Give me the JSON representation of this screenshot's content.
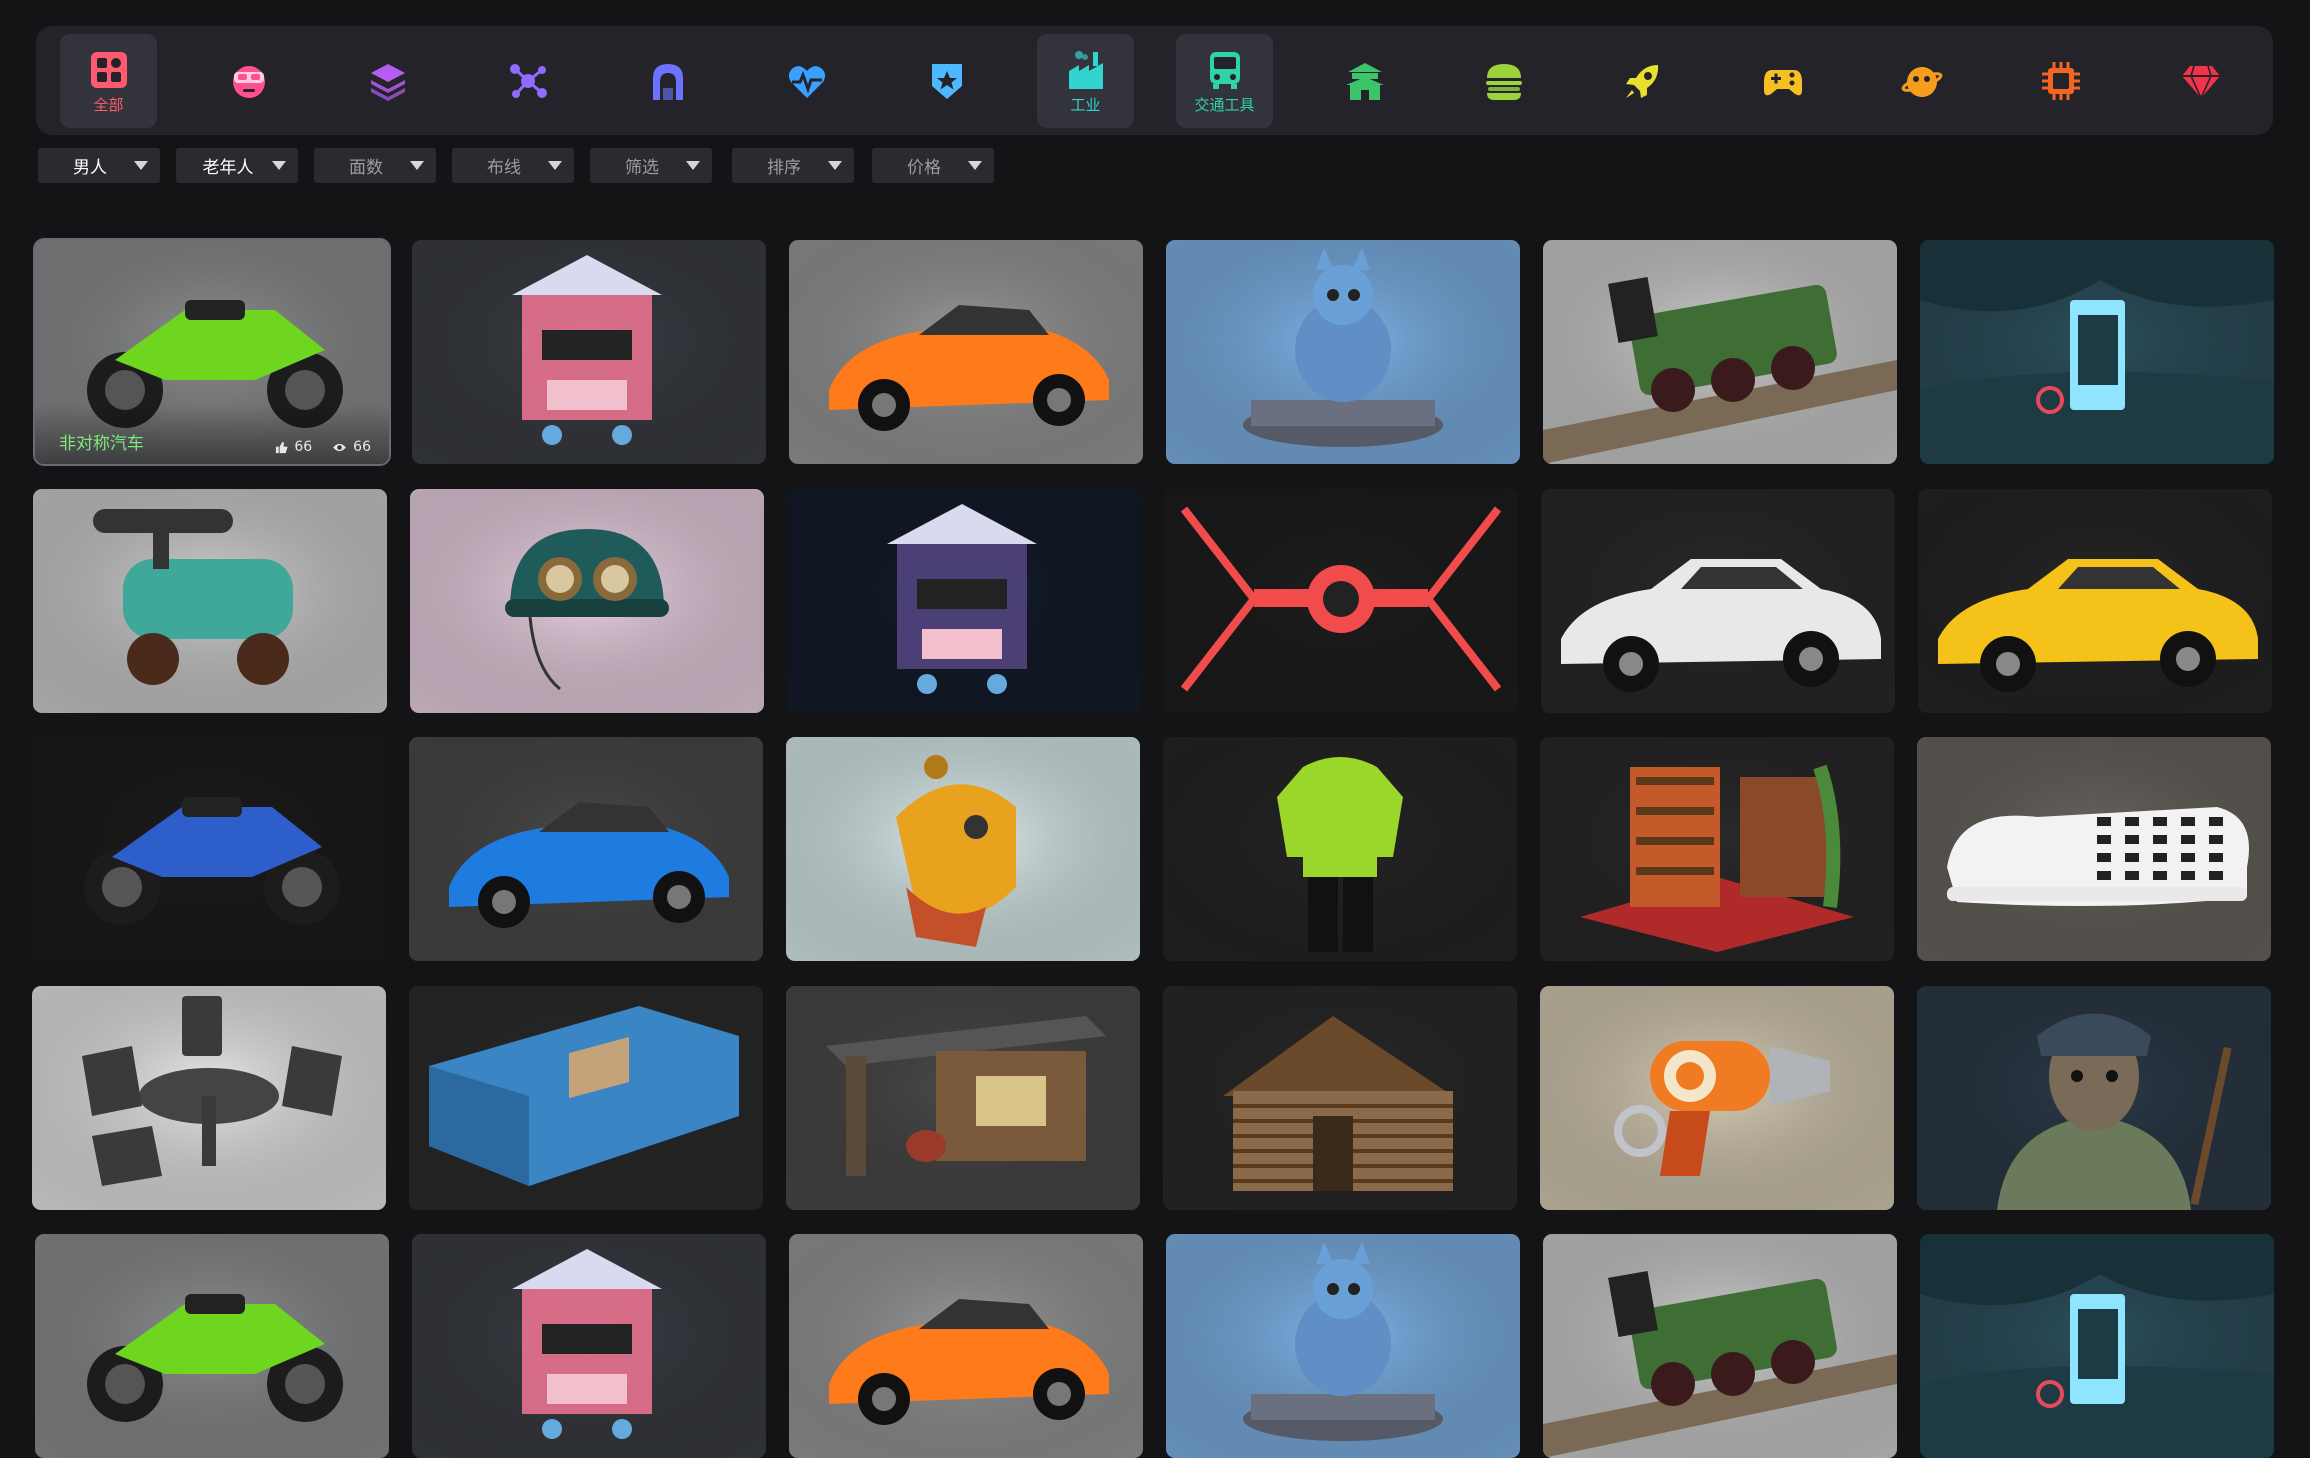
{
  "categories": [
    {
      "key": "all",
      "label": "全部",
      "icon": "all-grid-icon",
      "color": "#ff5a6e",
      "active": true
    },
    {
      "key": "character",
      "label": "",
      "icon": "vr-character-icon",
      "color": "#ff4f8e",
      "active": false
    },
    {
      "key": "layers",
      "label": "",
      "icon": "layers-icon",
      "color": "#b65cf2",
      "active": false
    },
    {
      "key": "molecule",
      "label": "",
      "icon": "molecule-icon",
      "color": "#8f6cff",
      "active": false
    },
    {
      "key": "arch",
      "label": "",
      "icon": "arch-tunnel-icon",
      "color": "#6a72ff",
      "active": false
    },
    {
      "key": "medical",
      "label": "",
      "icon": "heartbeat-icon",
      "color": "#3aa0ff",
      "active": false
    },
    {
      "key": "military",
      "label": "",
      "icon": "badge-star-icon",
      "color": "#4db8ff",
      "active": false
    },
    {
      "key": "industry",
      "label": "工业",
      "icon": "factory-icon",
      "color": "#33d3d0",
      "active": true
    },
    {
      "key": "transport",
      "label": "交通工具",
      "icon": "bus-icon",
      "color": "#2ed3a6",
      "active": true
    },
    {
      "key": "building",
      "label": "",
      "icon": "palace-icon",
      "color": "#3cc46a",
      "active": false
    },
    {
      "key": "food",
      "label": "",
      "icon": "burger-icon",
      "color": "#9bd33a",
      "active": false
    },
    {
      "key": "space",
      "label": "",
      "icon": "rocket-icon",
      "color": "#e8e02c",
      "active": false
    },
    {
      "key": "game",
      "label": "",
      "icon": "gamepad-icon",
      "color": "#f5c021",
      "active": false
    },
    {
      "key": "planet",
      "label": "",
      "icon": "planet-icon",
      "color": "#f59e1d",
      "active": false
    },
    {
      "key": "chip",
      "label": "",
      "icon": "cpu-chip-icon",
      "color": "#f26524",
      "active": false
    },
    {
      "key": "gem",
      "label": "",
      "icon": "gem-icon",
      "color": "#f2344a",
      "active": false
    }
  ],
  "filters": [
    {
      "label": "男人",
      "set": true
    },
    {
      "label": "老年人",
      "set": true
    },
    {
      "label": "面数",
      "set": false
    },
    {
      "label": "布线",
      "set": false
    },
    {
      "label": "筛选",
      "set": false
    },
    {
      "label": "排序",
      "set": false
    },
    {
      "label": "价格",
      "set": false
    }
  ],
  "hover_card": {
    "title": "非对称汽车",
    "likes": "66",
    "views": "66"
  },
  "models": [
    {
      "name": "green-motorcycle",
      "bg": "#8d8f91",
      "accent": "#6fd61f"
    },
    {
      "name": "neon-shop-building",
      "bg": "#3b3e45",
      "accent": "#ff7a9a"
    },
    {
      "name": "flame-race-car",
      "bg": "#9a9a9a",
      "accent": "#ff7a1a"
    },
    {
      "name": "robot-cat-statue",
      "bg": "#7fb3e8",
      "accent": "#5f8fc4"
    },
    {
      "name": "steam-locomotive",
      "bg": "#cfcfcf",
      "accent": "#3f6e35"
    },
    {
      "name": "phone-booth-scene",
      "bg": "#2c4f5d",
      "accent": "#8fe4ff"
    },
    {
      "name": "steam-engine-cart",
      "bg": "#d0d0d0",
      "accent": "#3fa89a"
    },
    {
      "name": "aviator-helmet",
      "bg": "#ecd3e4",
      "accent": "#205b5b"
    },
    {
      "name": "noodle-tram",
      "bg": "#141c2b",
      "accent": "#5a4a8a"
    },
    {
      "name": "red-tie-fighter",
      "bg": "#1e1e1e",
      "accent": "#f24b4b"
    },
    {
      "name": "sheriff-police-car",
      "bg": "#2a2a2a",
      "accent": "#e8e8e8"
    },
    {
      "name": "yellow-taxi",
      "bg": "#262626",
      "accent": "#f5c21a"
    },
    {
      "name": "blue-cruiser-motorbike",
      "bg": "#1c1c1c",
      "accent": "#2e5ec9"
    },
    {
      "name": "blue-sports-car",
      "bg": "#4a4a4a",
      "accent": "#1e7be0"
    },
    {
      "name": "robot-bird-character",
      "bg": "#ddeeee",
      "accent": "#e8a21e"
    },
    {
      "name": "green-jacket-outfit",
      "bg": "#262626",
      "accent": "#9bd62a"
    },
    {
      "name": "library-room-scene",
      "bg": "#2a2a2a",
      "accent": "#c45a2a"
    },
    {
      "name": "checkered-slip-on-shoe",
      "bg": "#6a6560",
      "accent": "#f2f2f2"
    },
    {
      "name": "patio-table-set",
      "bg": "#e9e9e9",
      "accent": "#3a3a3a"
    },
    {
      "name": "blue-shipping-container",
      "bg": "#2c2c2c",
      "accent": "#3a86c4"
    },
    {
      "name": "wooden-shack",
      "bg": "#4a4a4a",
      "accent": "#7a5a3a"
    },
    {
      "name": "log-cabin",
      "bg": "#2a2a2a",
      "accent": "#8a6a4a"
    },
    {
      "name": "ray-gun-toy",
      "bg": "#d7cdb5",
      "accent": "#f07b22"
    },
    {
      "name": "warrior-character-bust",
      "bg": "#2c3a48",
      "accent": "#6a7a5a"
    },
    {
      "name": "green-motorcycle-2",
      "bg": "#8d8f91",
      "accent": "#6fd61f"
    },
    {
      "name": "neon-shop-building-2",
      "bg": "#3b3e45",
      "accent": "#ff7a9a"
    },
    {
      "name": "flame-race-car-2",
      "bg": "#9a9a9a",
      "accent": "#ff7a1a"
    },
    {
      "name": "robot-cat-statue-2",
      "bg": "#7fb3e8",
      "accent": "#5f8fc4"
    },
    {
      "name": "steam-locomotive-2",
      "bg": "#cfcfcf",
      "accent": "#3f6e35"
    },
    {
      "name": "phone-booth-scene-2",
      "bg": "#2c4f5d",
      "accent": "#8fe4ff"
    }
  ]
}
